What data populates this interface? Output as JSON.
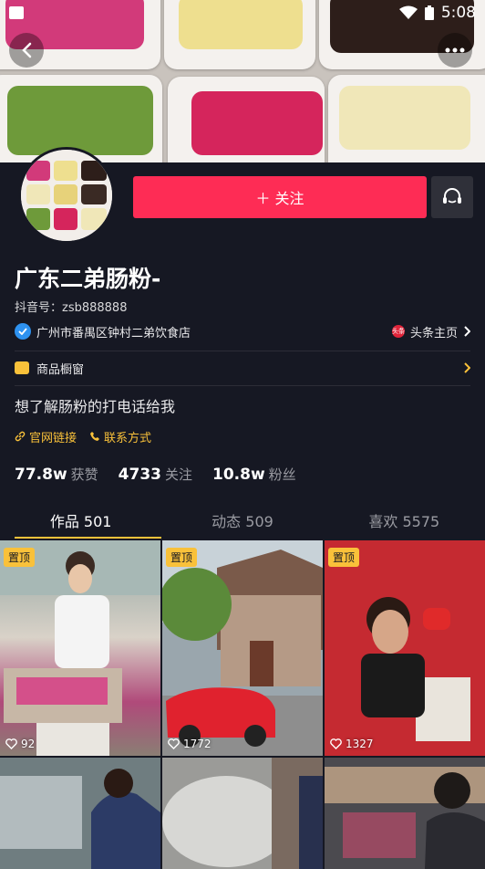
{
  "statusbar": {
    "time": "5:08"
  },
  "header": {
    "back_icon": "back-arrow-icon",
    "more_icon": "more-dots-icon"
  },
  "profile": {
    "follow_label": "＋ 关注",
    "name": "广东二弟肠粉-",
    "douyin_id": "抖音号：zsb888888",
    "verified_text": "广州市番禺区钟村二弟饮食店",
    "toutiao_label": "头条主页",
    "toutiao_badge": "头条",
    "shop_label": "商品橱窗",
    "bio": "想了解肠粉的打电话给我",
    "links": [
      {
        "label": "官网链接"
      },
      {
        "label": "联系方式"
      }
    ],
    "stats": [
      {
        "num": "77.8w",
        "label": "获赞"
      },
      {
        "num": "4733",
        "label": "关注"
      },
      {
        "num": "10.8w",
        "label": "粉丝"
      }
    ]
  },
  "tabs": [
    {
      "label": "作品 501"
    },
    {
      "label": "动态 509"
    },
    {
      "label": "喜欢 5575"
    }
  ],
  "videos": [
    {
      "pinned": "置顶",
      "likes": "92"
    },
    {
      "pinned": "置顶",
      "likes": "1772"
    },
    {
      "pinned": "置顶",
      "likes": "1327"
    },
    {
      "pinned": "",
      "likes": ""
    },
    {
      "pinned": "",
      "likes": ""
    },
    {
      "pinned": "",
      "likes": ""
    }
  ],
  "colors": {
    "accent": "#fe2c55",
    "yellow": "#f9c13a",
    "bg": "#161823"
  }
}
